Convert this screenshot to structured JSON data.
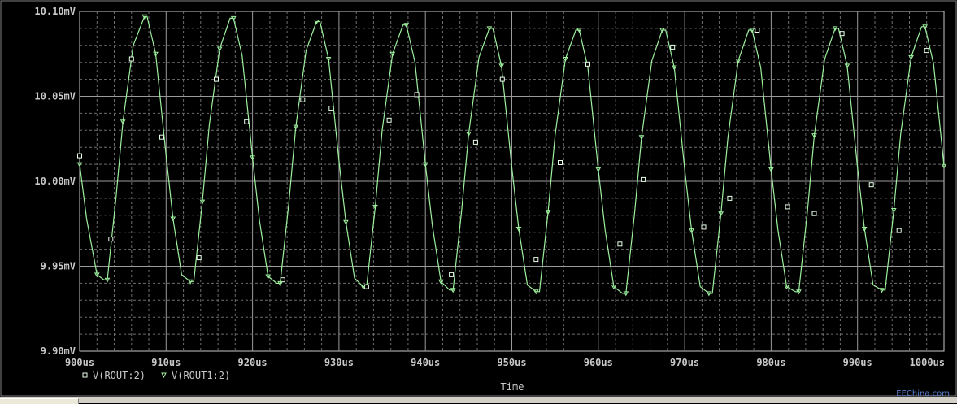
{
  "chart_data": {
    "type": "line",
    "xlabel": "Time",
    "xlim": [
      900,
      1000
    ],
    "ylim": [
      9.9,
      10.1
    ],
    "x_ticks": [
      900,
      910,
      920,
      930,
      940,
      950,
      960,
      970,
      980,
      990,
      1000
    ],
    "x_tick_labels": [
      "900us",
      "910us",
      "920us",
      "930us",
      "940us",
      "950us",
      "960us",
      "970us",
      "980us",
      "990us",
      "1000us"
    ],
    "y_ticks": [
      9.9,
      9.95,
      10.0,
      10.05,
      10.1
    ],
    "y_tick_labels": [
      "9.90mV",
      "9.95mV",
      "10.00mV",
      "10.05mV",
      "10.10mV"
    ],
    "grid": true,
    "legend_position": "bottom-left",
    "trace_color": "#9ef09e",
    "series": [
      {
        "name": "V(ROUT:2)",
        "marker": "square",
        "x": [
          900.0,
          903.6,
          906.0,
          909.5,
          913.8,
          915.8,
          919.3,
          923.5,
          925.8,
          929.1,
          933.2,
          935.8,
          939.0,
          943.0,
          945.8,
          948.9,
          952.8,
          955.6,
          958.8,
          962.5,
          965.2,
          968.6,
          972.2,
          975.2,
          978.4,
          981.9,
          985.0,
          988.2,
          991.6,
          994.8,
          998.0
        ],
        "y": [
          10.015,
          9.966,
          10.072,
          10.026,
          9.955,
          10.06,
          10.035,
          9.942,
          10.048,
          10.043,
          9.938,
          10.036,
          10.051,
          9.945,
          10.023,
          10.06,
          9.954,
          10.011,
          10.069,
          9.963,
          10.001,
          10.079,
          9.973,
          9.99,
          10.089,
          9.985,
          9.981,
          10.087,
          9.998,
          9.971,
          10.077
        ]
      },
      {
        "name": "V(ROUT1:2)",
        "marker": "triangle-down",
        "x": [
          900.0,
          900.8,
          902.0,
          902.8,
          903.2,
          904.2,
          905.0,
          906.2,
          907.5,
          907.8,
          908.8,
          910.0,
          910.8,
          911.8,
          912.8,
          913.2,
          914.2,
          915.0,
          916.2,
          917.4,
          917.8,
          918.8,
          920.0,
          920.8,
          921.8,
          922.8,
          923.2,
          924.2,
          925.0,
          926.2,
          927.4,
          927.8,
          928.8,
          930.0,
          930.8,
          931.8,
          932.8,
          933.2,
          934.2,
          935.0,
          936.2,
          937.4,
          937.8,
          938.8,
          940.0,
          940.8,
          941.8,
          942.8,
          943.2,
          944.2,
          945.0,
          946.2,
          947.4,
          947.8,
          948.8,
          950.0,
          950.8,
          951.8,
          952.8,
          953.2,
          954.2,
          955.0,
          956.2,
          957.4,
          957.8,
          958.8,
          960.0,
          960.8,
          961.8,
          962.8,
          963.2,
          964.2,
          965.0,
          966.2,
          967.4,
          967.8,
          968.8,
          970.0,
          970.8,
          971.8,
          972.8,
          973.2,
          974.2,
          975.0,
          976.2,
          977.4,
          977.8,
          978.8,
          980.0,
          980.8,
          981.8,
          982.8,
          983.2,
          984.2,
          985.0,
          986.2,
          987.4,
          987.8,
          988.8,
          990.0,
          990.8,
          991.8,
          992.8,
          993.2,
          994.2,
          995.0,
          996.2,
          997.4,
          997.8,
          998.8,
          1000.0
        ],
        "y": [
          10.01,
          9.978,
          9.945,
          9.942,
          9.942,
          9.99,
          10.035,
          10.08,
          10.097,
          10.097,
          10.075,
          10.015,
          9.978,
          9.945,
          9.941,
          9.941,
          9.988,
          10.033,
          10.078,
          10.096,
          10.096,
          10.074,
          10.014,
          9.977,
          9.944,
          9.94,
          9.94,
          9.987,
          10.032,
          10.077,
          10.094,
          10.094,
          10.072,
          10.012,
          9.976,
          9.943,
          9.938,
          9.938,
          9.985,
          10.03,
          10.075,
          10.092,
          10.092,
          10.07,
          10.01,
          9.974,
          9.941,
          9.936,
          9.936,
          9.983,
          10.028,
          10.073,
          10.09,
          10.09,
          10.068,
          10.008,
          9.972,
          9.939,
          9.935,
          9.935,
          9.982,
          10.027,
          10.072,
          10.089,
          10.089,
          10.067,
          10.007,
          9.971,
          9.938,
          9.934,
          9.934,
          9.981,
          10.026,
          10.071,
          10.089,
          10.089,
          10.067,
          10.007,
          9.971,
          9.938,
          9.934,
          9.934,
          9.981,
          10.026,
          10.071,
          10.089,
          10.089,
          10.067,
          10.007,
          9.971,
          9.938,
          9.935,
          9.935,
          9.982,
          10.027,
          10.072,
          10.09,
          10.09,
          10.068,
          10.008,
          9.972,
          9.939,
          9.936,
          9.936,
          9.983,
          10.028,
          10.073,
          10.091,
          10.091,
          10.069,
          10.009
        ]
      }
    ]
  },
  "watermark_text": "EEChina.com"
}
